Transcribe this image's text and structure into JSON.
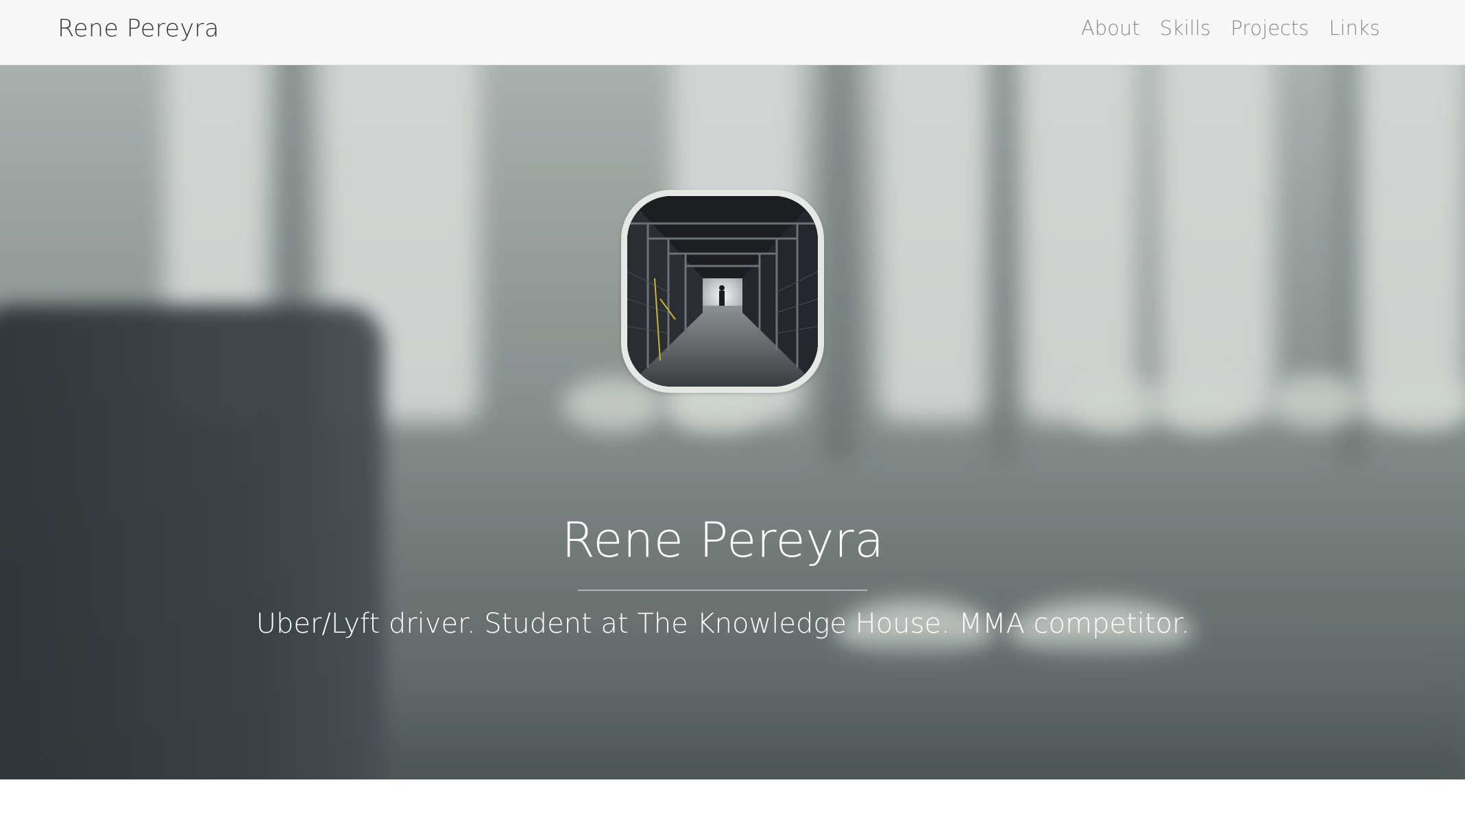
{
  "nav": {
    "brand": "Rene Pereyra",
    "links": [
      {
        "label": "About"
      },
      {
        "label": "Skills"
      },
      {
        "label": "Projects"
      },
      {
        "label": "Links"
      }
    ]
  },
  "hero": {
    "name": "Rene Pereyra",
    "tagline": "Uber/Lyft driver. Student at The Knowledge House. MMA competitor."
  },
  "colors": {
    "navbar_bg": "#f7f7f7",
    "brand_text": "#333333",
    "nav_link_text": "#8a8a8a",
    "hero_text": "#ffffff"
  }
}
